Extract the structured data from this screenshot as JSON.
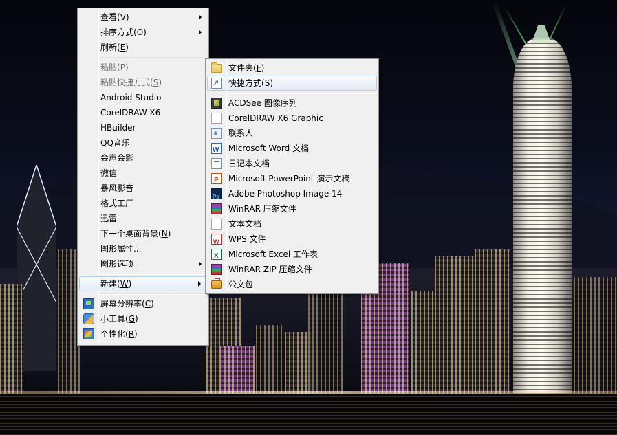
{
  "context_menu": {
    "items": [
      {
        "label": "查看",
        "mnemonic": "V",
        "submenu": true
      },
      {
        "label": "排序方式",
        "mnemonic": "O",
        "submenu": true
      },
      {
        "label": "刷新",
        "mnemonic": "E"
      },
      {
        "label": "粘贴",
        "mnemonic": "P",
        "disabled": true
      },
      {
        "label": "粘贴快捷方式",
        "mnemonic": "S",
        "disabled": true
      },
      {
        "label": "Android Studio"
      },
      {
        "label": "CorelDRAW X6"
      },
      {
        "label": "HBuilder"
      },
      {
        "label": "QQ音乐"
      },
      {
        "label": "会声会影"
      },
      {
        "label": "微信"
      },
      {
        "label": "暴风影音"
      },
      {
        "label": "格式工厂"
      },
      {
        "label": "迅雷"
      },
      {
        "label": "下一个桌面背景",
        "mnemonic": "N"
      },
      {
        "label": "图形属性..."
      },
      {
        "label": "图形选项",
        "submenu": true
      },
      {
        "label": "新建",
        "mnemonic": "W",
        "submenu": true,
        "active": true
      },
      {
        "label": "屏幕分辨率",
        "mnemonic": "C",
        "icon": "screen-resolution-icon"
      },
      {
        "label": "小工具",
        "mnemonic": "G",
        "icon": "gadgets-icon"
      },
      {
        "label": "个性化",
        "mnemonic": "R",
        "icon": "personalize-icon"
      }
    ]
  },
  "new_submenu": {
    "items": [
      {
        "label": "文件夹",
        "mnemonic": "F",
        "icon": "folder-icon"
      },
      {
        "label": "快捷方式",
        "mnemonic": "S",
        "icon": "shortcut-icon",
        "hover": true
      },
      {
        "label": "ACDSee 图像序列",
        "icon": "acdsee-icon"
      },
      {
        "label": "CorelDRAW X6 Graphic",
        "icon": "coreldraw-document-icon"
      },
      {
        "label": "联系人",
        "icon": "contact-icon"
      },
      {
        "label": "Microsoft Word 文档",
        "icon": "word-icon"
      },
      {
        "label": "日记本文档",
        "icon": "journal-icon"
      },
      {
        "label": "Microsoft PowerPoint 演示文稿",
        "icon": "powerpoint-icon"
      },
      {
        "label": "Adobe Photoshop Image 14",
        "icon": "photoshop-icon"
      },
      {
        "label": "WinRAR 压缩文件",
        "icon": "winrar-icon"
      },
      {
        "label": "文本文档",
        "icon": "text-document-icon"
      },
      {
        "label": "WPS 文件",
        "icon": "wps-icon"
      },
      {
        "label": "Microsoft Excel 工作表",
        "icon": "excel-icon"
      },
      {
        "label": "WinRAR ZIP 压缩文件",
        "icon": "winrar-zip-icon"
      },
      {
        "label": "公文包",
        "icon": "briefcase-icon"
      }
    ]
  },
  "colors": {
    "menu_background": "#f0f0f0",
    "menu_border": "#979797",
    "hover_border": "#aecff7",
    "text": "#000000",
    "disabled_text": "#6d6d6d"
  }
}
